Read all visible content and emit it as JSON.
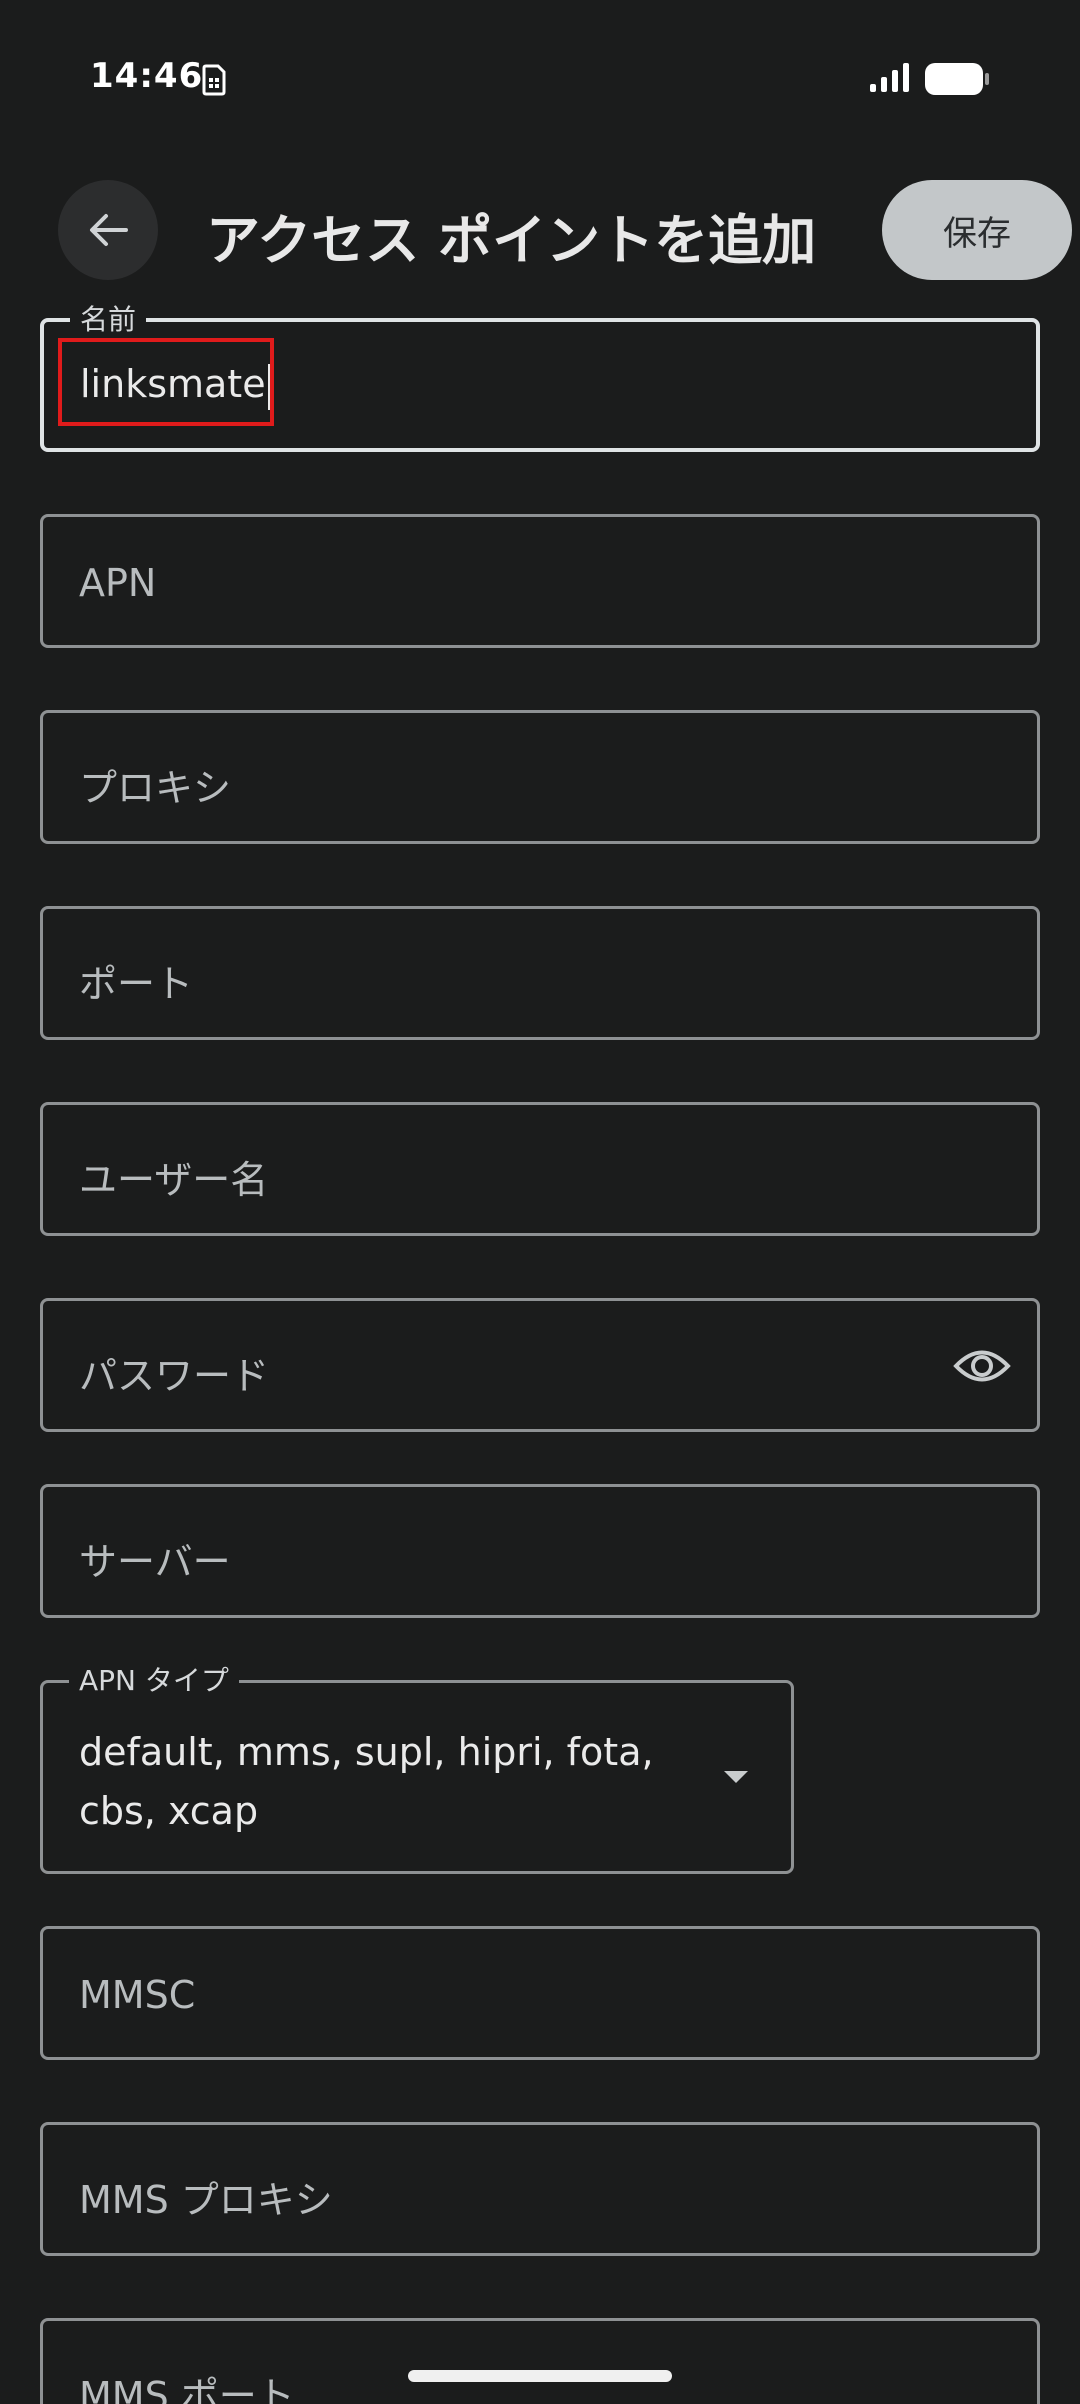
{
  "status_bar": {
    "time": "14:46"
  },
  "app_bar": {
    "title": "アクセス ポイントを追加",
    "save_label": "保存"
  },
  "fields": {
    "name": {
      "label": "名前",
      "value": "linksmate"
    },
    "apn": {
      "placeholder": "APN"
    },
    "proxy": {
      "placeholder": "プロキシ"
    },
    "port": {
      "placeholder": "ポート"
    },
    "username": {
      "placeholder": "ユーザー名"
    },
    "password": {
      "placeholder": "パスワード"
    },
    "server": {
      "placeholder": "サーバー"
    },
    "apn_type": {
      "label": "APN タイプ",
      "value": "default, mms, supl, hipri, fota, cbs, xcap"
    },
    "mmsc": {
      "placeholder": "MMSC"
    },
    "mms_proxy": {
      "placeholder": "MMS プロキシ"
    },
    "mms_port": {
      "placeholder": "MMS ポート"
    }
  }
}
